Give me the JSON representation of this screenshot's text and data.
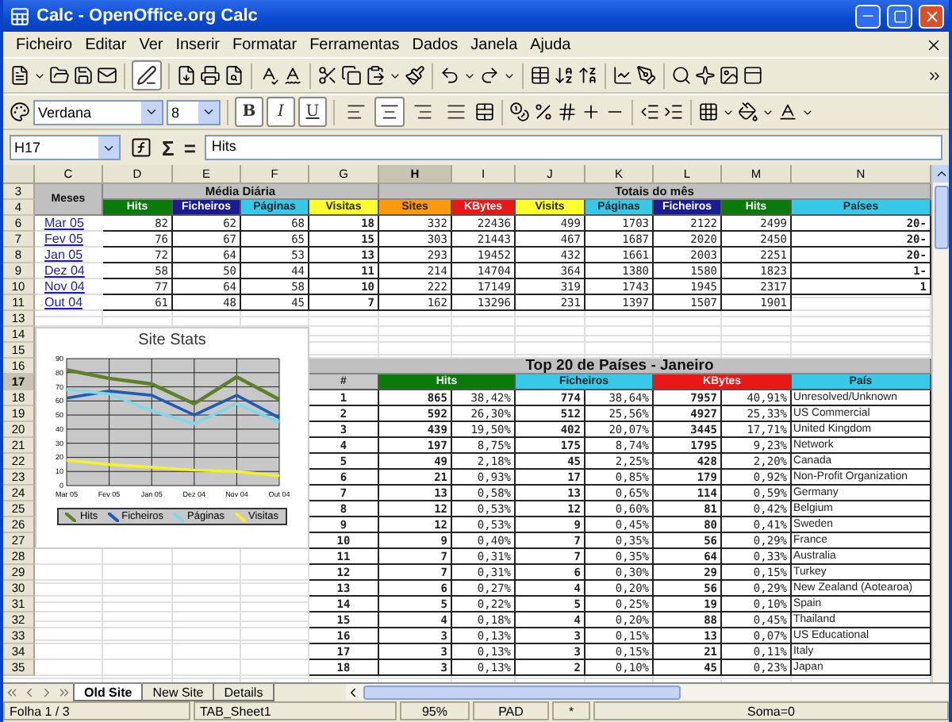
{
  "window": {
    "title": "Calc - OpenOffice.org Calc"
  },
  "menu": [
    "Ficheiro",
    "Editar",
    "Ver",
    "Inserir",
    "Formatar",
    "Ferramentas",
    "Dados",
    "Janela",
    "Ajuda"
  ],
  "standard_toolbar": {
    "edit_mode": true
  },
  "formatting_toolbar": {
    "font": "Verdana",
    "size": "8",
    "bold": "B",
    "italic": "I",
    "underline": "U",
    "alignment": {
      "left": false,
      "center": true,
      "right": false,
      "justify": false
    }
  },
  "formula_bar": {
    "cell": "H17",
    "sum": "Σ",
    "equals": "=",
    "content": "Hits"
  },
  "columns": [
    {
      "label": "C",
      "selected": false
    },
    {
      "label": "D",
      "selected": false
    },
    {
      "label": "E",
      "selected": false
    },
    {
      "label": "F",
      "selected": false
    },
    {
      "label": "G",
      "selected": false
    },
    {
      "label": "H",
      "selected": true
    },
    {
      "label": "I",
      "selected": false
    },
    {
      "label": "J",
      "selected": false
    },
    {
      "label": "K",
      "selected": false
    },
    {
      "label": "L",
      "selected": false
    },
    {
      "label": "M",
      "selected": false
    },
    {
      "label": "N",
      "selected": false
    }
  ],
  "rows": [
    {
      "label": "3",
      "selected": false
    },
    {
      "label": "4",
      "selected": false
    },
    {
      "label": "6",
      "selected": false
    },
    {
      "label": "7",
      "selected": false
    },
    {
      "label": "8",
      "selected": false
    },
    {
      "label": "9",
      "selected": false
    },
    {
      "label": "10",
      "selected": false
    },
    {
      "label": "11",
      "selected": false
    },
    {
      "label": "13",
      "selected": false
    },
    {
      "label": "14",
      "selected": false
    },
    {
      "label": "15",
      "selected": false
    },
    {
      "label": "16",
      "selected": false
    },
    {
      "label": "17",
      "selected": true
    },
    {
      "label": "18",
      "selected": false
    },
    {
      "label": "19",
      "selected": false
    },
    {
      "label": "20",
      "selected": false
    },
    {
      "label": "21",
      "selected": false
    },
    {
      "label": "22",
      "selected": false
    },
    {
      "label": "23",
      "selected": false
    },
    {
      "label": "24",
      "selected": false
    },
    {
      "label": "25",
      "selected": false
    },
    {
      "label": "26",
      "selected": false
    },
    {
      "label": "27",
      "selected": false
    },
    {
      "label": "28",
      "selected": false
    },
    {
      "label": "29",
      "selected": false
    },
    {
      "label": "30",
      "selected": false
    },
    {
      "label": "31",
      "selected": false
    },
    {
      "label": "32",
      "selected": false
    },
    {
      "label": "33",
      "selected": false
    },
    {
      "label": "34",
      "selected": false
    },
    {
      "label": "35",
      "selected": false
    }
  ],
  "monthly_table": {
    "row_label": "Meses",
    "groups": [
      "Média Diária",
      "Totais do mês"
    ],
    "headers": [
      {
        "label": "Hits",
        "color": "#0a7a0a"
      },
      {
        "label": "Ficheiros",
        "color": "#1c1c90"
      },
      {
        "label": "Páginas",
        "color": "#38c8e8"
      },
      {
        "label": "Visitas",
        "color": "#ffff30"
      },
      {
        "label": "Sites",
        "color": "#ff9a10"
      },
      {
        "label": "KBytes",
        "color": "#e81818"
      },
      {
        "label": "Visits",
        "color": "#ffff30"
      },
      {
        "label": "Páginas",
        "color": "#38c8e8"
      },
      {
        "label": "Ficheiros",
        "color": "#1c1c90"
      },
      {
        "label": "Hits",
        "color": "#0a7a0a"
      },
      {
        "label": "Países",
        "color": "#38c8e8"
      }
    ],
    "rows": [
      {
        "month": "Mar 05",
        "values": [
          "82",
          "62",
          "68",
          "18",
          "332",
          "22436",
          "499",
          "1703",
          "2122",
          "2499",
          "20-"
        ]
      },
      {
        "month": "Fev 05",
        "values": [
          "76",
          "67",
          "65",
          "15",
          "303",
          "21443",
          "467",
          "1687",
          "2020",
          "2450",
          "20-"
        ]
      },
      {
        "month": "Jan 05",
        "values": [
          "72",
          "64",
          "53",
          "13",
          "293",
          "19452",
          "432",
          "1661",
          "2003",
          "2251",
          "20-"
        ]
      },
      {
        "month": "Dez 04",
        "values": [
          "58",
          "50",
          "44",
          "11",
          "214",
          "14704",
          "364",
          "1380",
          "1580",
          "1823",
          "1-"
        ]
      },
      {
        "month": "Nov 04",
        "values": [
          "77",
          "64",
          "58",
          "10",
          "222",
          "17149",
          "319",
          "1743",
          "1945",
          "2317",
          "1"
        ]
      },
      {
        "month": "Out 04",
        "values": [
          "61",
          "48",
          "45",
          "7",
          "162",
          "13296",
          "231",
          "1397",
          "1507",
          "1901"
        ]
      }
    ]
  },
  "chart": {
    "title": "Site Stats",
    "chart_data": {
      "type": "line",
      "grid": true,
      "categories": [
        "Mar 05",
        "Fev 05",
        "Jan 05",
        "Dez 04",
        "Nov 04",
        "Out 04"
      ],
      "ylim": [
        0,
        90
      ],
      "yticks": [
        0,
        10,
        20,
        30,
        40,
        50,
        60,
        70,
        80,
        90
      ],
      "series": [
        {
          "name": "Hits",
          "color": "#5f7f2a",
          "values": [
            82,
            76,
            72,
            58,
            77,
            61
          ]
        },
        {
          "name": "Ficheiros",
          "color": "#1c5cb4",
          "values": [
            62,
            67,
            64,
            50,
            64,
            48
          ]
        },
        {
          "name": "Páginas",
          "color": "#80d8e8",
          "values": [
            68,
            65,
            53,
            44,
            58,
            45
          ]
        },
        {
          "name": "Visitas",
          "color": "#f4f030",
          "values": [
            18,
            15,
            13,
            11,
            10,
            7
          ]
        }
      ]
    }
  },
  "countries_table": {
    "title": "Top 20 de Países - Janeiro",
    "headers": [
      {
        "label": "#",
        "color": "#c8c8c8"
      },
      {
        "label": "Hits",
        "color": "#0a7a0a"
      },
      {
        "label": "Ficheiros",
        "color": "#38c8e8"
      },
      {
        "label": "KBytes",
        "color": "#e81818"
      },
      {
        "label": "País",
        "color": "#38c8e8"
      }
    ],
    "rows": [
      [
        "1",
        "865",
        "38,42%",
        "774",
        "38,64%",
        "7957",
        "40,91%",
        "Unresolved/Unknown"
      ],
      [
        "2",
        "592",
        "26,30%",
        "512",
        "25,56%",
        "4927",
        "25,33%",
        "US Commercial"
      ],
      [
        "3",
        "439",
        "19,50%",
        "402",
        "20,07%",
        "3445",
        "17,71%",
        "United Kingdom"
      ],
      [
        "4",
        "197",
        "8,75%",
        "175",
        "8,74%",
        "1795",
        "9,23%",
        "Network"
      ],
      [
        "5",
        "49",
        "2,18%",
        "45",
        "2,25%",
        "428",
        "2,20%",
        "Canada"
      ],
      [
        "6",
        "21",
        "0,93%",
        "17",
        "0,85%",
        "179",
        "0,92%",
        "Non-Profit Organization"
      ],
      [
        "7",
        "13",
        "0,58%",
        "13",
        "0,65%",
        "114",
        "0,59%",
        "Germany"
      ],
      [
        "8",
        "12",
        "0,53%",
        "12",
        "0,60%",
        "81",
        "0,42%",
        "Belgium"
      ],
      [
        "9",
        "12",
        "0,53%",
        "9",
        "0,45%",
        "80",
        "0,41%",
        "Sweden"
      ],
      [
        "10",
        "9",
        "0,40%",
        "7",
        "0,35%",
        "56",
        "0,29%",
        "France"
      ],
      [
        "11",
        "7",
        "0,31%",
        "7",
        "0,35%",
        "64",
        "0,33%",
        "Australia"
      ],
      [
        "12",
        "7",
        "0,31%",
        "6",
        "0,30%",
        "29",
        "0,15%",
        "Turkey"
      ],
      [
        "13",
        "6",
        "0,27%",
        "4",
        "0,20%",
        "56",
        "0,29%",
        "New Zealand (Aotearoa)"
      ],
      [
        "14",
        "5",
        "0,22%",
        "5",
        "0,25%",
        "19",
        "0,10%",
        "Spain"
      ],
      [
        "15",
        "4",
        "0,18%",
        "4",
        "0,20%",
        "88",
        "0,45%",
        "Thailand"
      ],
      [
        "16",
        "3",
        "0,13%",
        "3",
        "0,15%",
        "13",
        "0,07%",
        "US Educational"
      ],
      [
        "17",
        "3",
        "0,13%",
        "3",
        "0,15%",
        "21",
        "0,11%",
        "Italy"
      ],
      [
        "18",
        "3",
        "0,13%",
        "2",
        "0,10%",
        "45",
        "0,23%",
        "Japan"
      ]
    ]
  },
  "sheet_tabs": [
    {
      "label": "Old Site",
      "selected": true
    },
    {
      "label": "New Site",
      "selected": false
    },
    {
      "label": "Details",
      "selected": false
    }
  ],
  "status_bar": {
    "sheet": "Folha 1 / 3",
    "page_style": "TAB_Sheet1",
    "zoom": "95%",
    "mode": "PAD",
    "modified": "*",
    "sum": "Soma=0"
  }
}
